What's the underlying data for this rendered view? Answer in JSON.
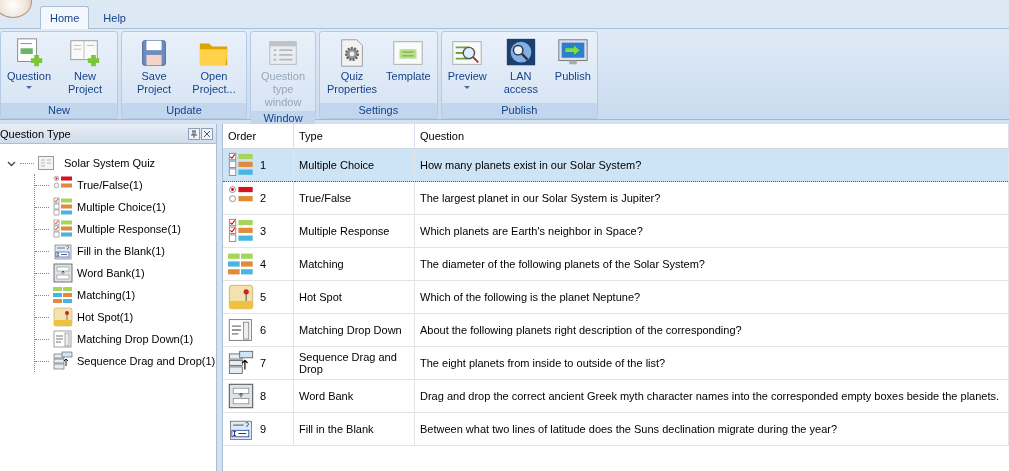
{
  "tabs": [
    {
      "label": "Home",
      "selected": true
    },
    {
      "label": "Help",
      "selected": false
    }
  ],
  "ribbon_groups": [
    {
      "label": "New",
      "buttons": [
        {
          "label": "Question",
          "kind": "question",
          "dropdown": true,
          "disabled": false
        },
        {
          "label": "New Project",
          "kind": "new_project",
          "dropdown": false,
          "disabled": false
        }
      ]
    },
    {
      "label": "Update",
      "buttons": [
        {
          "label": "Save Project",
          "kind": "save",
          "dropdown": false,
          "disabled": false
        },
        {
          "label": "Open Project...",
          "kind": "open",
          "dropdown": false,
          "disabled": false
        }
      ]
    },
    {
      "label": "Window",
      "buttons": [
        {
          "label": "Question type window",
          "kind": "window",
          "dropdown": false,
          "disabled": true
        }
      ]
    },
    {
      "label": "Settings",
      "buttons": [
        {
          "label": "Quiz Properties",
          "kind": "properties",
          "dropdown": false,
          "disabled": false
        },
        {
          "label": "Template",
          "kind": "template",
          "dropdown": false,
          "disabled": false
        }
      ]
    },
    {
      "label": "Publish",
      "buttons": [
        {
          "label": "Preview",
          "kind": "preview",
          "dropdown": true,
          "disabled": false
        },
        {
          "label": "LAN access",
          "kind": "lan",
          "dropdown": false,
          "disabled": false
        },
        {
          "label": "Publish",
          "kind": "publish",
          "dropdown": false,
          "disabled": false
        }
      ]
    }
  ],
  "question_type_panel": {
    "title": "Question Type",
    "tree": {
      "label": "Solar System Quiz",
      "expanded": true,
      "children": [
        {
          "label": "True/False(1)",
          "kind": "true_false"
        },
        {
          "label": "Multiple Choice(1)",
          "kind": "multiple_choice"
        },
        {
          "label": "Multiple Response(1)",
          "kind": "multiple_response"
        },
        {
          "label": "Fill in the Blank(1)",
          "kind": "fill_blank"
        },
        {
          "label": "Word Bank(1)",
          "kind": "word_bank"
        },
        {
          "label": "Matching(1)",
          "kind": "matching"
        },
        {
          "label": "Hot Spot(1)",
          "kind": "hot_spot"
        },
        {
          "label": "Matching Drop Down(1)",
          "kind": "matching_dropdown"
        },
        {
          "label": "Sequence Drag and Drop(1)",
          "kind": "sequence"
        }
      ]
    }
  },
  "table": {
    "columns": [
      "Order",
      "Type",
      "Question"
    ],
    "rows": [
      {
        "order": "1",
        "type": "Multiple Choice",
        "kind": "multiple_choice",
        "question": "How many planets exist in our Solar System?",
        "selected": true
      },
      {
        "order": "2",
        "type": "True/False",
        "kind": "true_false",
        "question": "The largest planet in our Solar System is Jupiter?",
        "selected": false
      },
      {
        "order": "3",
        "type": "Multiple Response",
        "kind": "multiple_response",
        "question": "Which planets are Earth's neighbor in Space?",
        "selected": false
      },
      {
        "order": "4",
        "type": "Matching",
        "kind": "matching",
        "question": "The diameter of the following planets of the Solar System?",
        "selected": false
      },
      {
        "order": "5",
        "type": "Hot Spot",
        "kind": "hot_spot",
        "question": "Which of the following is the planet Neptune?",
        "selected": false
      },
      {
        "order": "6",
        "type": "Matching Drop Down",
        "kind": "matching_dropdown",
        "question": "About the following planets right description of the corresponding?",
        "selected": false
      },
      {
        "order": "7",
        "type": "Sequence Drag and Drop",
        "kind": "sequence",
        "question": "The eight planets from inside to outside of the list?",
        "selected": false
      },
      {
        "order": "8",
        "type": "Word Bank",
        "kind": "word_bank",
        "question": "Drag and drop the correct ancient Greek myth character names into the corresponded empty boxes beside the planets.",
        "selected": false
      },
      {
        "order": "9",
        "type": "Fill in the Blank",
        "kind": "fill_blank",
        "question": "Between what two lines of latitude does the Suns declination migrate during the year?",
        "selected": false
      }
    ]
  }
}
